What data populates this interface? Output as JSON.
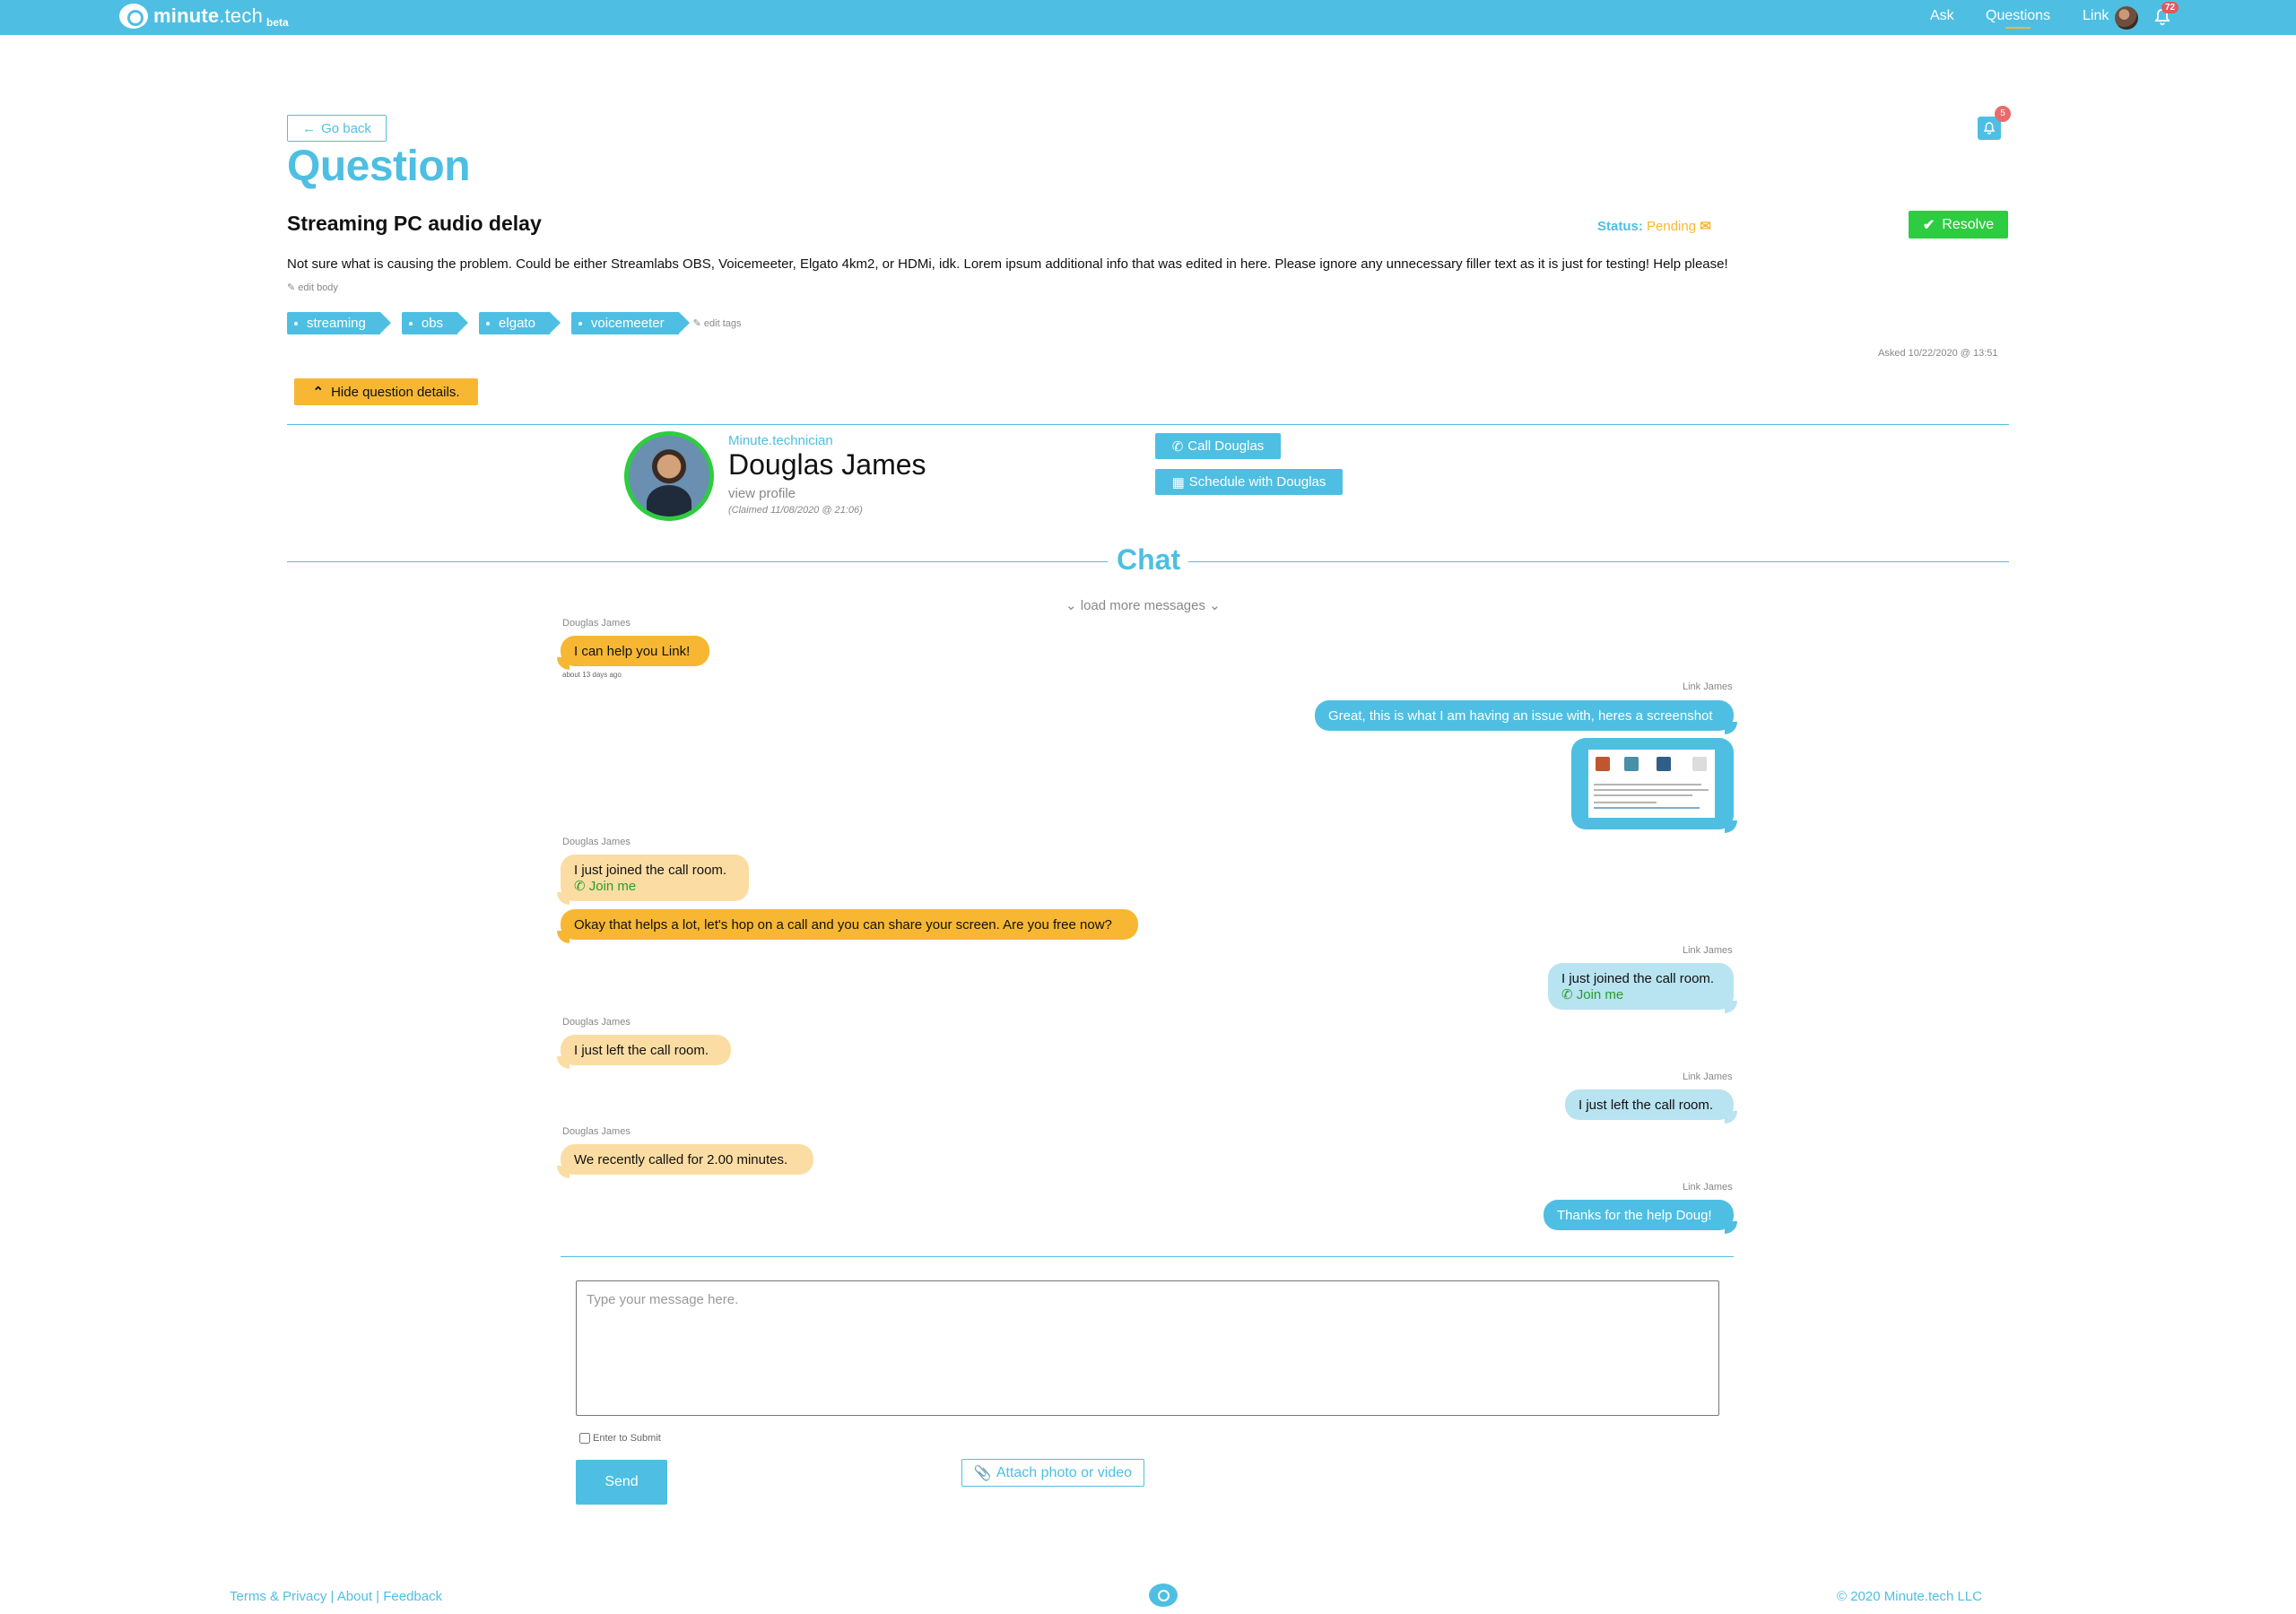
{
  "nav": {
    "brand_main": "minute",
    "brand_tld": ".tech",
    "brand_beta": "beta",
    "ask": "Ask",
    "questions": "Questions",
    "user": "Link",
    "bell_count": "72"
  },
  "page": {
    "go_back": "Go back",
    "title": "Question",
    "notif_count": "5"
  },
  "question": {
    "title": "Streaming PC audio delay",
    "status_label": "Status:",
    "status_value": "Pending",
    "resolve": "Resolve",
    "body": "Not sure what is causing the problem. Could be either Streamlabs OBS, Voicemeeter, Elgato 4km2, or HDMi, idk. Lorem ipsum additional info that was edited in here. Please ignore any unnecessary filler text as it is just for testing! Help please!",
    "edit_body": "edit body",
    "tags": [
      "streaming",
      "obs",
      "elgato",
      "voicemeeter"
    ],
    "edit_tags": "edit tags",
    "asked": "Asked 10/22/2020 @ 13:51",
    "hide_details": "Hide question details."
  },
  "technician": {
    "role": "Minute.technician",
    "name": "Douglas James",
    "view_profile": "view profile",
    "claimed": "(Claimed 11/08/2020 @ 21:06)",
    "call": "Call Douglas",
    "schedule": "Schedule with Douglas"
  },
  "chat": {
    "title": "Chat",
    "load_more": "load more messages",
    "messages": [
      {
        "sender": "Douglas James",
        "text": "I can help you Link!",
        "time": "about 13 days ago"
      },
      {
        "sender": "Link James",
        "text": "Great, this is what I am having an issue with, heres a screenshot"
      },
      {
        "sender": "Douglas James",
        "text": "I just joined the call room.",
        "link": "Join me"
      },
      {
        "sender": "",
        "text": "Okay that helps a lot, let's hop on a call and you can share your screen. Are you free now?"
      },
      {
        "sender": "Link James",
        "text": "I just joined the call room.",
        "link": "Join me"
      },
      {
        "sender": "Douglas James",
        "text": "I just left the call room."
      },
      {
        "sender": "Link James",
        "text": "I just left the call room."
      },
      {
        "sender": "Douglas James",
        "text": "We recently called for 2.00 minutes."
      },
      {
        "sender": "Link James",
        "text": "Thanks for the help Doug!"
      }
    ],
    "input_placeholder": "Type your message here.",
    "enter_to_submit": "Enter to Submit",
    "send": "Send",
    "attach": "Attach photo or video"
  },
  "footer": {
    "terms": "Terms & Privacy",
    "about": "About",
    "feedback": "Feedback",
    "sep": "|",
    "copyright": "© 2020 Minute.tech LLC"
  },
  "colors": {
    "brand_blue": "#4ebfe2",
    "pending_orange": "#f7b733",
    "resolve_green": "#2ecc40",
    "join_green": "#2a9d2a"
  },
  "icons": [
    "logo-icon",
    "bell-icon",
    "arrow-left-icon",
    "check-icon",
    "chevron-up-icon",
    "phone-icon",
    "calendar-icon",
    "chevron-down-icon",
    "paperclip-icon",
    "edit-icon",
    "handshake-icon"
  ]
}
